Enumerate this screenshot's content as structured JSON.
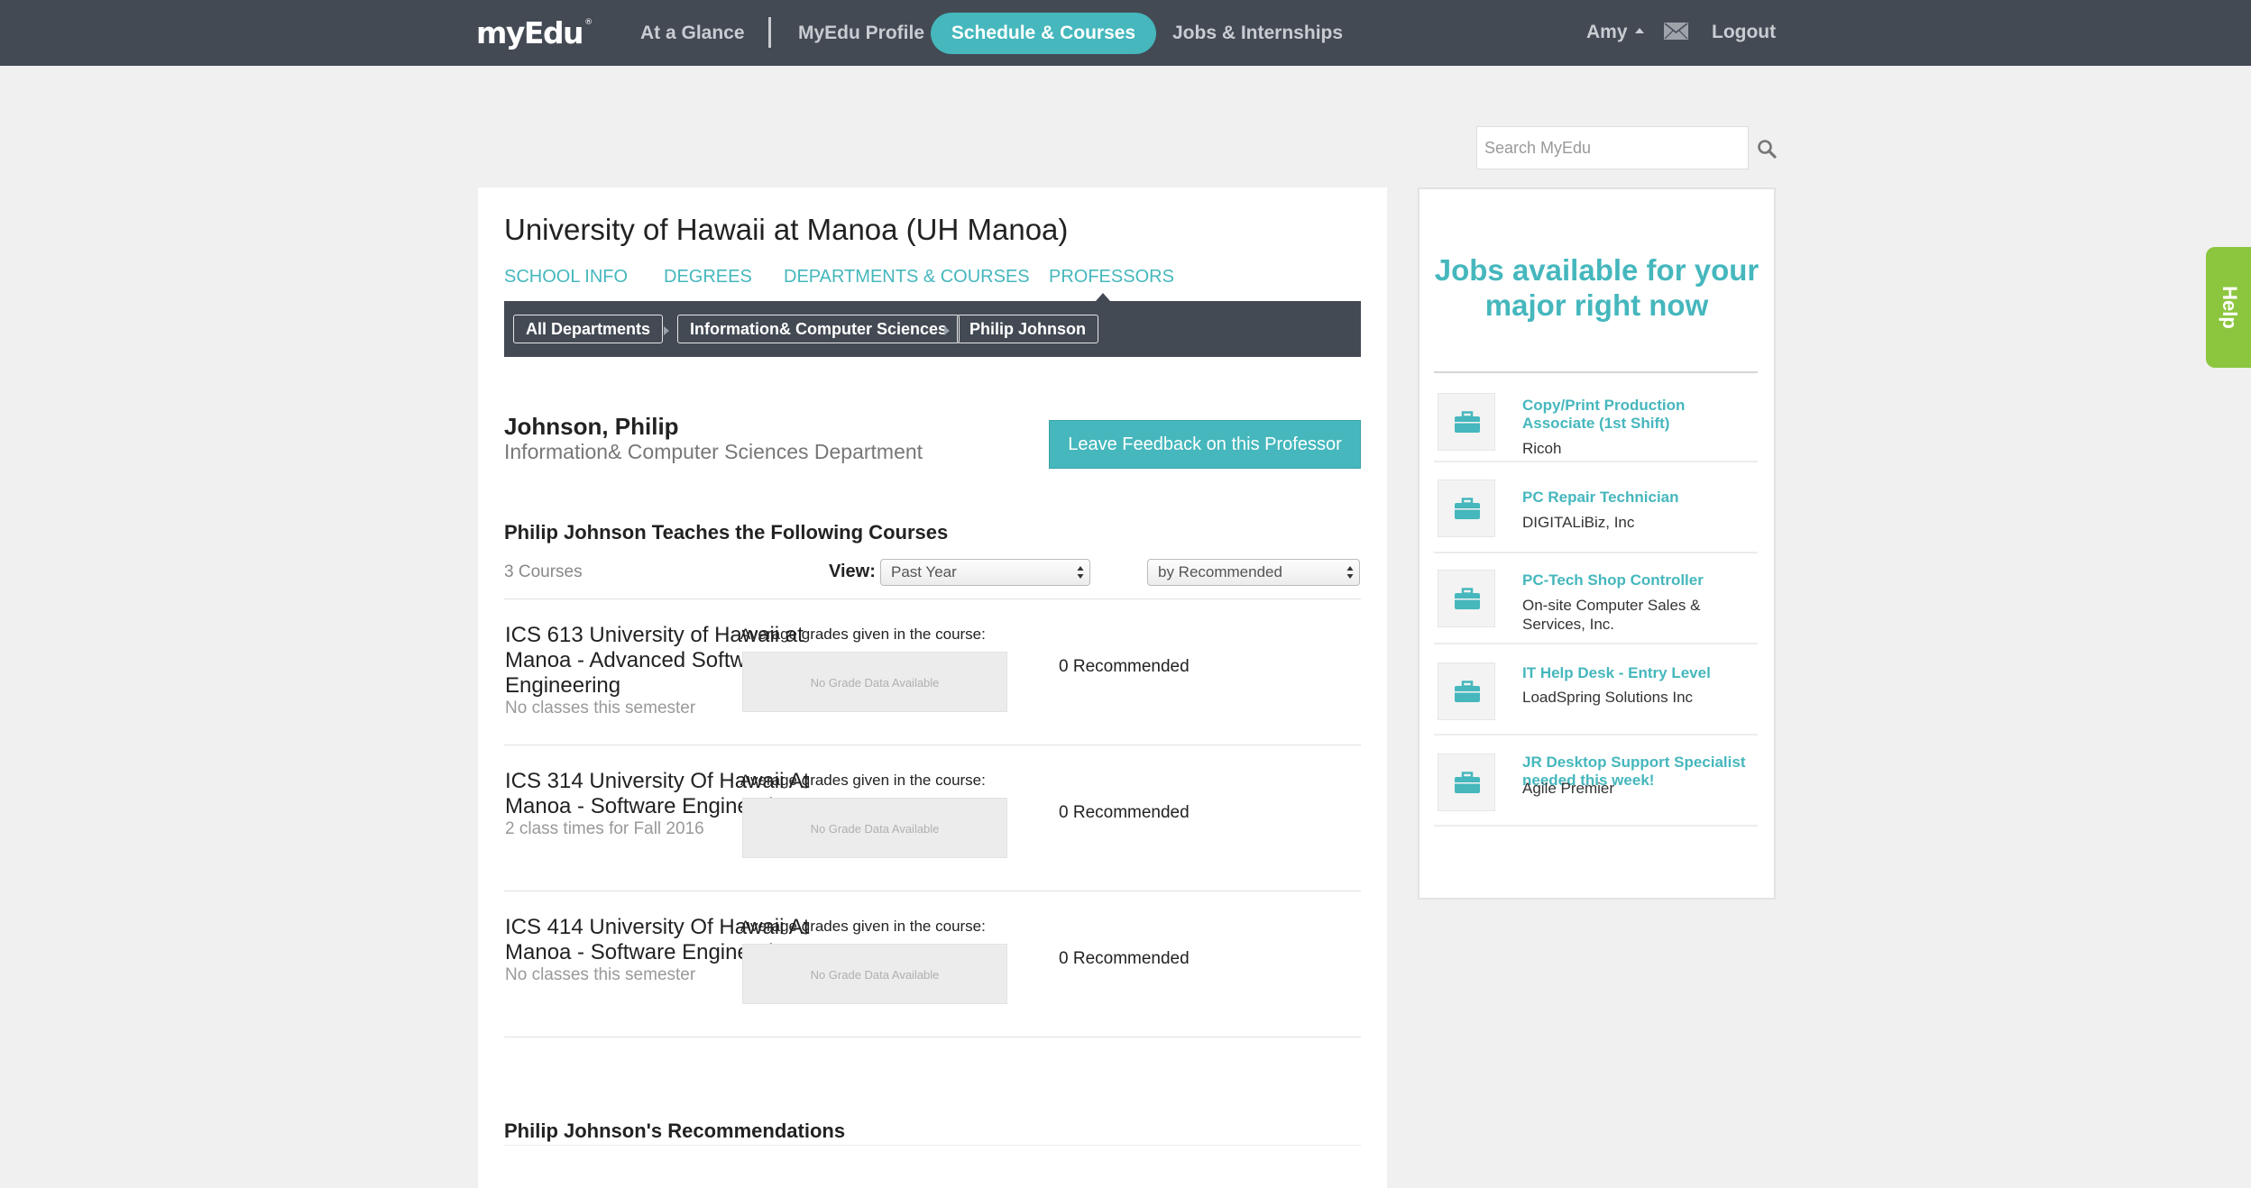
{
  "brand": {
    "logo": "myEdu",
    "mark": "®",
    "accent": "#45b7bd",
    "nav_bg": "#434a54",
    "help_color": "#8cc63f"
  },
  "nav": {
    "items": [
      "At a Glance",
      "MyEdu Profile",
      "Schedule & Courses",
      "Jobs & Internships"
    ],
    "active": "Schedule & Courses",
    "user": "Amy",
    "mail_icon": "envelope-icon",
    "logout": "Logout"
  },
  "search": {
    "placeholder": "Search MyEdu",
    "icon": "search-icon"
  },
  "school": {
    "title": "University of Hawaii at Manoa (UH Manoa)",
    "tabs": [
      "SCHOOL INFO",
      "DEGREES",
      "DEPARTMENTS & COURSES",
      "PROFESSORS"
    ],
    "active_tab": "PROFESSORS"
  },
  "breadcrumb": [
    "All Departments",
    "Information& Computer Sciences",
    "Philip Johnson"
  ],
  "professor": {
    "name": "Johnson, Philip",
    "department": "Information& Computer Sciences Department",
    "feedback_button": "Leave Feedback on this Professor"
  },
  "courses": {
    "heading": "Philip Johnson Teaches the Following Courses",
    "count": "3 Courses",
    "view_label": "View:",
    "period_select": "Past Year",
    "sort_select": "by Recommended",
    "grades_label": "Average grades given in the course:",
    "no_grade_data": "No Grade Data Available",
    "items": [
      {
        "title": "ICS 613 University of Hawaii at Manoa - Advanced Software Engineering",
        "status": "No classes this semester",
        "recommended": "0 Recommended"
      },
      {
        "title": "ICS 314 University Of Hawaii At Manoa - Software Engineering I",
        "status": "2 class times for Fall 2016",
        "recommended": "0 Recommended"
      },
      {
        "title": "ICS 414 University Of Hawaii At Manoa - Software Engineering II",
        "status": "No classes this semester",
        "recommended": "0 Recommended"
      }
    ]
  },
  "recommendations": {
    "heading": "Philip Johnson's Recommendations"
  },
  "jobs": {
    "heading": "Jobs available for your major right now",
    "icon": "briefcase-icon",
    "items": [
      {
        "title": "Copy/Print Production Associate (1st Shift)",
        "company": "Ricoh"
      },
      {
        "title": "PC Repair Technician",
        "company": "DIGITALiBiz, Inc"
      },
      {
        "title": "PC-Tech Shop Controller",
        "company": "On-site Computer Sales & Services, Inc."
      },
      {
        "title": "IT Help Desk - Entry Level",
        "company": "LoadSpring Solutions Inc"
      },
      {
        "title": "JR Desktop Support Specialist needed this week!",
        "company": "Agile Premier"
      }
    ]
  },
  "help": {
    "label": "Help"
  }
}
